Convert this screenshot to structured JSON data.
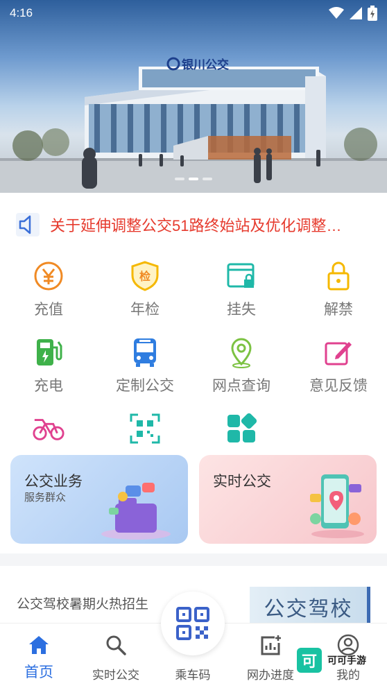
{
  "status_bar": {
    "time": "4:16"
  },
  "banner": {
    "building_sign": "银川公交"
  },
  "notice": {
    "text": "关于延伸调整公交51路终始站及优化调整…"
  },
  "grid": [
    {
      "label": "充值",
      "icon": "yuan-recharge-icon",
      "color": "#f08a24"
    },
    {
      "label": "年检",
      "icon": "inspection-shield-icon",
      "color": "#f5b800"
    },
    {
      "label": "挂失",
      "icon": "lock-card-icon",
      "color": "#1fb8a8"
    },
    {
      "label": "解禁",
      "icon": "unlock-icon",
      "color": "#f5b800"
    },
    {
      "label": "充电",
      "icon": "charging-station-icon",
      "color": "#3fb14a"
    },
    {
      "label": "定制公交",
      "icon": "bus-icon",
      "color": "#2f7de0"
    },
    {
      "label": "网点查询",
      "icon": "location-pin-icon",
      "color": "#7cc242"
    },
    {
      "label": "意见反馈",
      "icon": "feedback-edit-icon",
      "color": "#e0418f"
    },
    {
      "label": "",
      "icon": "bicycle-icon",
      "color": "#e0418f"
    },
    {
      "label": "",
      "icon": "qr-scan-icon",
      "color": "#1fb8a8"
    },
    {
      "label": "",
      "icon": "apps-grid-icon",
      "color": "#1fb8a8"
    }
  ],
  "cards": {
    "business": {
      "title": "公交业务",
      "subtitle": "服务群众"
    },
    "realtime": {
      "title": "实时公交"
    }
  },
  "news": {
    "text": "公交驾校暑期火热招生",
    "image_text": "公交驾校"
  },
  "nav": {
    "home": "首页",
    "realtime": "实时公交",
    "ride_code": "乘车码",
    "progress": "网办进度",
    "mine": "我的"
  },
  "watermark": {
    "logo": "可",
    "text": "可可手游"
  },
  "colors": {
    "primary": "#2c6fe0",
    "notice": "#e63a2d"
  }
}
